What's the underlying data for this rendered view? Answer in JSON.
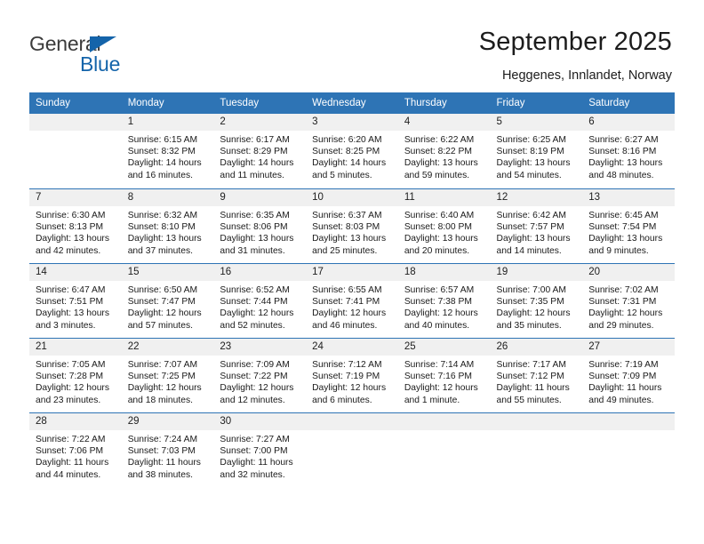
{
  "brand": {
    "name_part1": "General",
    "name_part2": "Blue",
    "triangle_color": "#1464aa",
    "text_color": "#3b3b3b"
  },
  "header": {
    "title": "September 2025",
    "subtitle": "Heggenes, Innlandet, Norway",
    "header_bg_color": "#2e74b5",
    "daynum_bg_color": "#f0f0f0"
  },
  "weekday_headers": [
    "Sunday",
    "Monday",
    "Tuesday",
    "Wednesday",
    "Thursday",
    "Friday",
    "Saturday"
  ],
  "weeks": [
    [
      {
        "day": "",
        "sunrise": "",
        "sunset": "",
        "daylight1": "",
        "daylight2": ""
      },
      {
        "day": "1",
        "sunrise": "Sunrise: 6:15 AM",
        "sunset": "Sunset: 8:32 PM",
        "daylight1": "Daylight: 14 hours",
        "daylight2": "and 16 minutes."
      },
      {
        "day": "2",
        "sunrise": "Sunrise: 6:17 AM",
        "sunset": "Sunset: 8:29 PM",
        "daylight1": "Daylight: 14 hours",
        "daylight2": "and 11 minutes."
      },
      {
        "day": "3",
        "sunrise": "Sunrise: 6:20 AM",
        "sunset": "Sunset: 8:25 PM",
        "daylight1": "Daylight: 14 hours",
        "daylight2": "and 5 minutes."
      },
      {
        "day": "4",
        "sunrise": "Sunrise: 6:22 AM",
        "sunset": "Sunset: 8:22 PM",
        "daylight1": "Daylight: 13 hours",
        "daylight2": "and 59 minutes."
      },
      {
        "day": "5",
        "sunrise": "Sunrise: 6:25 AM",
        "sunset": "Sunset: 8:19 PM",
        "daylight1": "Daylight: 13 hours",
        "daylight2": "and 54 minutes."
      },
      {
        "day": "6",
        "sunrise": "Sunrise: 6:27 AM",
        "sunset": "Sunset: 8:16 PM",
        "daylight1": "Daylight: 13 hours",
        "daylight2": "and 48 minutes."
      }
    ],
    [
      {
        "day": "7",
        "sunrise": "Sunrise: 6:30 AM",
        "sunset": "Sunset: 8:13 PM",
        "daylight1": "Daylight: 13 hours",
        "daylight2": "and 42 minutes."
      },
      {
        "day": "8",
        "sunrise": "Sunrise: 6:32 AM",
        "sunset": "Sunset: 8:10 PM",
        "daylight1": "Daylight: 13 hours",
        "daylight2": "and 37 minutes."
      },
      {
        "day": "9",
        "sunrise": "Sunrise: 6:35 AM",
        "sunset": "Sunset: 8:06 PM",
        "daylight1": "Daylight: 13 hours",
        "daylight2": "and 31 minutes."
      },
      {
        "day": "10",
        "sunrise": "Sunrise: 6:37 AM",
        "sunset": "Sunset: 8:03 PM",
        "daylight1": "Daylight: 13 hours",
        "daylight2": "and 25 minutes."
      },
      {
        "day": "11",
        "sunrise": "Sunrise: 6:40 AM",
        "sunset": "Sunset: 8:00 PM",
        "daylight1": "Daylight: 13 hours",
        "daylight2": "and 20 minutes."
      },
      {
        "day": "12",
        "sunrise": "Sunrise: 6:42 AM",
        "sunset": "Sunset: 7:57 PM",
        "daylight1": "Daylight: 13 hours",
        "daylight2": "and 14 minutes."
      },
      {
        "day": "13",
        "sunrise": "Sunrise: 6:45 AM",
        "sunset": "Sunset: 7:54 PM",
        "daylight1": "Daylight: 13 hours",
        "daylight2": "and 9 minutes."
      }
    ],
    [
      {
        "day": "14",
        "sunrise": "Sunrise: 6:47 AM",
        "sunset": "Sunset: 7:51 PM",
        "daylight1": "Daylight: 13 hours",
        "daylight2": "and 3 minutes."
      },
      {
        "day": "15",
        "sunrise": "Sunrise: 6:50 AM",
        "sunset": "Sunset: 7:47 PM",
        "daylight1": "Daylight: 12 hours",
        "daylight2": "and 57 minutes."
      },
      {
        "day": "16",
        "sunrise": "Sunrise: 6:52 AM",
        "sunset": "Sunset: 7:44 PM",
        "daylight1": "Daylight: 12 hours",
        "daylight2": "and 52 minutes."
      },
      {
        "day": "17",
        "sunrise": "Sunrise: 6:55 AM",
        "sunset": "Sunset: 7:41 PM",
        "daylight1": "Daylight: 12 hours",
        "daylight2": "and 46 minutes."
      },
      {
        "day": "18",
        "sunrise": "Sunrise: 6:57 AM",
        "sunset": "Sunset: 7:38 PM",
        "daylight1": "Daylight: 12 hours",
        "daylight2": "and 40 minutes."
      },
      {
        "day": "19",
        "sunrise": "Sunrise: 7:00 AM",
        "sunset": "Sunset: 7:35 PM",
        "daylight1": "Daylight: 12 hours",
        "daylight2": "and 35 minutes."
      },
      {
        "day": "20",
        "sunrise": "Sunrise: 7:02 AM",
        "sunset": "Sunset: 7:31 PM",
        "daylight1": "Daylight: 12 hours",
        "daylight2": "and 29 minutes."
      }
    ],
    [
      {
        "day": "21",
        "sunrise": "Sunrise: 7:05 AM",
        "sunset": "Sunset: 7:28 PM",
        "daylight1": "Daylight: 12 hours",
        "daylight2": "and 23 minutes."
      },
      {
        "day": "22",
        "sunrise": "Sunrise: 7:07 AM",
        "sunset": "Sunset: 7:25 PM",
        "daylight1": "Daylight: 12 hours",
        "daylight2": "and 18 minutes."
      },
      {
        "day": "23",
        "sunrise": "Sunrise: 7:09 AM",
        "sunset": "Sunset: 7:22 PM",
        "daylight1": "Daylight: 12 hours",
        "daylight2": "and 12 minutes."
      },
      {
        "day": "24",
        "sunrise": "Sunrise: 7:12 AM",
        "sunset": "Sunset: 7:19 PM",
        "daylight1": "Daylight: 12 hours",
        "daylight2": "and 6 minutes."
      },
      {
        "day": "25",
        "sunrise": "Sunrise: 7:14 AM",
        "sunset": "Sunset: 7:16 PM",
        "daylight1": "Daylight: 12 hours",
        "daylight2": "and 1 minute."
      },
      {
        "day": "26",
        "sunrise": "Sunrise: 7:17 AM",
        "sunset": "Sunset: 7:12 PM",
        "daylight1": "Daylight: 11 hours",
        "daylight2": "and 55 minutes."
      },
      {
        "day": "27",
        "sunrise": "Sunrise: 7:19 AM",
        "sunset": "Sunset: 7:09 PM",
        "daylight1": "Daylight: 11 hours",
        "daylight2": "and 49 minutes."
      }
    ],
    [
      {
        "day": "28",
        "sunrise": "Sunrise: 7:22 AM",
        "sunset": "Sunset: 7:06 PM",
        "daylight1": "Daylight: 11 hours",
        "daylight2": "and 44 minutes."
      },
      {
        "day": "29",
        "sunrise": "Sunrise: 7:24 AM",
        "sunset": "Sunset: 7:03 PM",
        "daylight1": "Daylight: 11 hours",
        "daylight2": "and 38 minutes."
      },
      {
        "day": "30",
        "sunrise": "Sunrise: 7:27 AM",
        "sunset": "Sunset: 7:00 PM",
        "daylight1": "Daylight: 11 hours",
        "daylight2": "and 32 minutes."
      },
      {
        "day": "",
        "sunrise": "",
        "sunset": "",
        "daylight1": "",
        "daylight2": ""
      },
      {
        "day": "",
        "sunrise": "",
        "sunset": "",
        "daylight1": "",
        "daylight2": ""
      },
      {
        "day": "",
        "sunrise": "",
        "sunset": "",
        "daylight1": "",
        "daylight2": ""
      },
      {
        "day": "",
        "sunrise": "",
        "sunset": "",
        "daylight1": "",
        "daylight2": ""
      }
    ]
  ]
}
